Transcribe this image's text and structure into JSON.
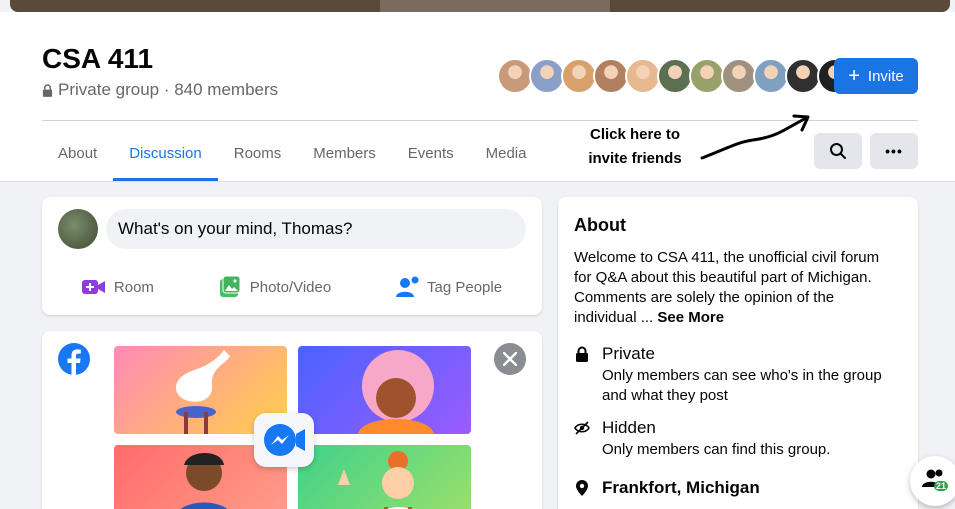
{
  "group": {
    "title": "CSA 411",
    "meta": "Private group · 840 members"
  },
  "header": {
    "invite_label": "Invite",
    "member_avatars": [
      {
        "color": "#c89a7a"
      },
      {
        "color": "#8aa0c8"
      },
      {
        "color": "#d8a06a"
      },
      {
        "color": "#b08060"
      },
      {
        "color": "#e8b890"
      },
      {
        "color": "#5a7050"
      },
      {
        "color": "#9aa06a"
      },
      {
        "color": "#a09080"
      },
      {
        "color": "#80a0c0"
      },
      {
        "color": "#303030"
      },
      {
        "color": "#202020"
      }
    ]
  },
  "tabs": [
    {
      "label": "About"
    },
    {
      "label": "Discussion"
    },
    {
      "label": "Rooms"
    },
    {
      "label": "Members"
    },
    {
      "label": "Events"
    },
    {
      "label": "Media"
    }
  ],
  "annotation": {
    "line1": "Click here to",
    "line2": "invite friends"
  },
  "composer": {
    "prompt": "What's on your mind, Thomas?",
    "actions": [
      {
        "label": "Room",
        "icon": "video-plus-icon",
        "color": "#8c3ddb"
      },
      {
        "label": "Photo/Video",
        "icon": "photo-icon",
        "color": "#45bd62"
      },
      {
        "label": "Tag People",
        "icon": "tag-people-icon",
        "color": "#1877f2"
      }
    ]
  },
  "about": {
    "heading": "About",
    "description": "Welcome to CSA 411, the unofficial civil forum for Q&A about this beautiful part of Michigan. Comments are solely the opinion of the individual ... ",
    "see_more": "See More",
    "private": {
      "title": "Private",
      "subtitle": "Only members can see who's in the group and what they post"
    },
    "hidden": {
      "title": "Hidden",
      "subtitle": "Only members can find this group."
    },
    "location": {
      "title": "Frankfort, Michigan"
    }
  },
  "chat": {
    "count": "21"
  },
  "colors": {
    "brand": "#1b74e4",
    "secondary_text": "#65676b"
  }
}
